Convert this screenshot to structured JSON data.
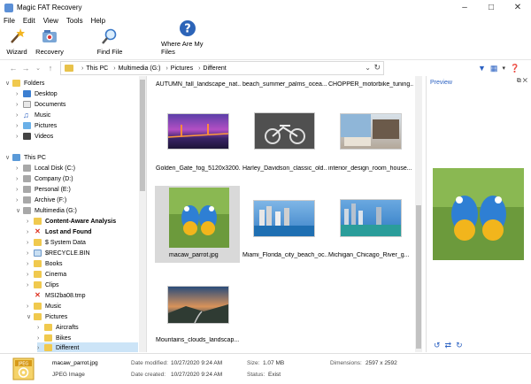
{
  "window": {
    "title": "Magic FAT Recovery"
  },
  "menu": [
    "File",
    "Edit",
    "View",
    "Tools",
    "Help"
  ],
  "toolbar": {
    "wizard": "Wizard",
    "recovery": "Recovery",
    "find_file": "Find File",
    "where_files": "Where Are My Files"
  },
  "address": {
    "crumbs": [
      "This PC",
      "Multimedia (G:)",
      "Pictures",
      "Different"
    ]
  },
  "tree": {
    "folders": "Folders",
    "desktop": "Desktop",
    "documents": "Documents",
    "music": "Music",
    "pictures": "Pictures",
    "videos": "Videos",
    "this_pc": "This PC",
    "local_disk": "Local Disk (C:)",
    "company": "Company (D:)",
    "personal": "Personal (E:)",
    "archive": "Archive (F:)",
    "multimedia": "Multimedia (G:)",
    "content_aware": "Content-Aware Analysis",
    "lost_found": "Lost and Found",
    "system_data": "$ System Data",
    "recycle": "$RECYCLE.BIN",
    "books": "Books",
    "cinema": "Cinema",
    "clips": "Clips",
    "msi": "MSI2ba08.tmp",
    "music2": "Music",
    "pictures2": "Pictures",
    "aircrafts": "Aircrafts",
    "bikes": "Bikes",
    "different": "Different"
  },
  "files": {
    "top1": "AUTUMN_fall_landscape_nat...",
    "top2": "beach_summer_palms_ocea...",
    "top3": "CHOPPER_motorbike_tuning...",
    "r1c1": "Golden_Gate_fog_5120x3200...",
    "r1c2": "Harley_Davidson_classic_old...",
    "r1c3": "interior_design_room_house...",
    "r2c1": "macaw_parrot.jpg",
    "r2c2": "Miami_Florida_city_beach_oc...",
    "r2c3": "Michigan_Chicago_River_g...",
    "r3c1": "Mountains_clouds_landscap..."
  },
  "preview": {
    "title": "Preview"
  },
  "status": {
    "filename": "macaw_parrot.jpg",
    "filetype": "JPEG Image",
    "modified_label": "Date modified:",
    "modified_value": "10/27/2020 9:24 AM",
    "created_label": "Date created:",
    "created_value": "10/27/2020 9:24 AM",
    "size_label": "Size:",
    "size_value": "1.07 MB",
    "status_label": "Status:",
    "status_value": "Exist",
    "dims_label": "Dimensions:",
    "dims_value": "2597 x 2592",
    "icon_text": "JPEG"
  }
}
